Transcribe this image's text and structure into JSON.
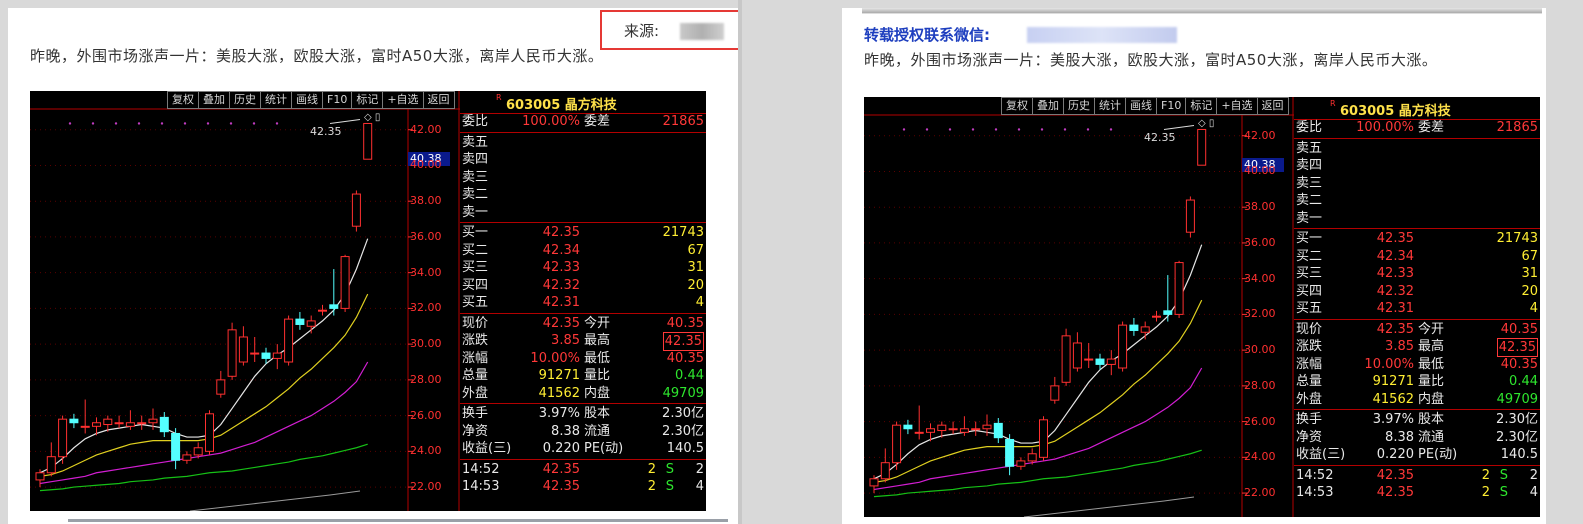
{
  "left": {
    "intro": "昨晚，外围市场涨声一片：美股大涨，欧股大涨，富时A50大涨，离岸人民币大涨。",
    "source_label": "来源:"
  },
  "right": {
    "reprint": "转载授权联系微信:",
    "intro": "昨晚，外围市场涨声一片：美股大涨，欧股大涨，富时A50大涨，离岸人民币大涨。"
  },
  "terminal": {
    "toolbar": [
      "复权",
      "叠加",
      "历史",
      "统计",
      "画线",
      "F10",
      "标记",
      "+自选",
      "返回"
    ],
    "axis_labels": [
      "42.00",
      "40.00",
      "38.00",
      "36.00",
      "34.00",
      "32.00",
      "30.00",
      "28.00",
      "26.00",
      "24.00",
      "22.00"
    ],
    "current_price": "40.38",
    "high_mark": "42.35",
    "stock_r": "R",
    "stock": "603005 晶方科技",
    "weibi": {
      "label": "委比",
      "value": "100.00%",
      "label2": "委差",
      "value2": "21865"
    },
    "asks": [
      "卖五",
      "卖四",
      "卖三",
      "卖二",
      "卖一"
    ],
    "bids": [
      {
        "label": "买一",
        "price": "42.35",
        "vol": "21743"
      },
      {
        "label": "买二",
        "price": "42.34",
        "vol": "67"
      },
      {
        "label": "买三",
        "price": "42.33",
        "vol": "31"
      },
      {
        "label": "买四",
        "price": "42.32",
        "vol": "20"
      },
      {
        "label": "买五",
        "price": "42.31",
        "vol": "4"
      }
    ],
    "stats": [
      {
        "l1": "现价",
        "v1": "42.35",
        "l2": "今开",
        "v2": "40.35"
      },
      {
        "l1": "涨跌",
        "v1": "3.85",
        "l2": "最高",
        "v2": "42.35"
      },
      {
        "l1": "涨幅",
        "v1": "10.00%",
        "l2": "最低",
        "v2": "40.35"
      },
      {
        "l1": "总量",
        "v1": "91271",
        "l2": "量比",
        "v2": "0.44"
      },
      {
        "l1": "外盘",
        "v1": "41562",
        "l2": "内盘",
        "v2": "49709"
      }
    ],
    "stats2": [
      {
        "l1": "换手",
        "v1": "3.97%",
        "l2": "股本",
        "v2": "2.30亿"
      },
      {
        "l1": "净资",
        "v1": "8.38",
        "l2": "流通",
        "v2": "2.30亿"
      },
      {
        "l1": "收益(三)",
        "v1": "0.220",
        "l2": "PE(动)",
        "v2": "140.5"
      }
    ],
    "ticks": [
      {
        "time": "14:52",
        "price": "42.35",
        "vol": "2",
        "dir": "S",
        "n": "2"
      },
      {
        "time": "14:53",
        "price": "42.35",
        "vol": "2",
        "dir": "S",
        "n": "4"
      }
    ]
  },
  "chart_data": {
    "type": "candlestick",
    "ylim": [
      21.5,
      42.6
    ],
    "candles": [
      {
        "o": 22.4,
        "h": 23.0,
        "l": 22.0,
        "c": 22.8
      },
      {
        "o": 22.8,
        "h": 24.5,
        "l": 22.6,
        "c": 23.7
      },
      {
        "o": 23.7,
        "h": 26.0,
        "l": 23.3,
        "c": 25.8
      },
      {
        "o": 25.8,
        "h": 26.1,
        "l": 25.3,
        "c": 25.6
      },
      {
        "o": 25.4,
        "h": 26.9,
        "l": 25.0,
        "c": 25.4
      },
      {
        "o": 25.4,
        "h": 25.9,
        "l": 24.9,
        "c": 25.6
      },
      {
        "o": 25.5,
        "h": 26.0,
        "l": 25.1,
        "c": 25.8
      },
      {
        "o": 25.6,
        "h": 26.0,
        "l": 25.3,
        "c": 25.6
      },
      {
        "o": 25.4,
        "h": 26.3,
        "l": 25.2,
        "c": 25.6
      },
      {
        "o": 25.6,
        "h": 26.0,
        "l": 25.2,
        "c": 25.6
      },
      {
        "o": 25.6,
        "h": 26.4,
        "l": 25.2,
        "c": 25.8
      },
      {
        "o": 25.9,
        "h": 26.2,
        "l": 24.8,
        "c": 25.1
      },
      {
        "o": 25.0,
        "h": 25.3,
        "l": 23.0,
        "c": 23.5
      },
      {
        "o": 23.5,
        "h": 24.0,
        "l": 23.3,
        "c": 23.8
      },
      {
        "o": 23.8,
        "h": 24.5,
        "l": 23.6,
        "c": 24.2
      },
      {
        "o": 24.0,
        "h": 26.3,
        "l": 23.8,
        "c": 26.1
      },
      {
        "o": 27.2,
        "h": 28.5,
        "l": 27.0,
        "c": 28.0
      },
      {
        "o": 28.2,
        "h": 31.2,
        "l": 28.0,
        "c": 30.8
      },
      {
        "o": 29.0,
        "h": 31.0,
        "l": 28.8,
        "c": 30.4
      },
      {
        "o": 29.5,
        "h": 30.4,
        "l": 29.0,
        "c": 29.5
      },
      {
        "o": 29.5,
        "h": 29.8,
        "l": 28.9,
        "c": 29.2
      },
      {
        "o": 29.2,
        "h": 30.0,
        "l": 28.6,
        "c": 29.5
      },
      {
        "o": 29.0,
        "h": 31.6,
        "l": 28.8,
        "c": 31.4
      },
      {
        "o": 31.4,
        "h": 31.8,
        "l": 30.8,
        "c": 31.1
      },
      {
        "o": 31.0,
        "h": 31.6,
        "l": 30.6,
        "c": 31.3
      },
      {
        "o": 31.9,
        "h": 32.2,
        "l": 31.6,
        "c": 31.9
      },
      {
        "o": 32.2,
        "h": 34.2,
        "l": 31.6,
        "c": 32.0
      },
      {
        "o": 32.0,
        "h": 35.0,
        "l": 31.8,
        "c": 34.9
      },
      {
        "o": 36.6,
        "h": 38.6,
        "l": 36.3,
        "c": 38.4
      },
      {
        "o": 40.35,
        "h": 42.35,
        "l": 40.35,
        "c": 42.35
      }
    ],
    "ma5": [
      22.8,
      23.1,
      23.6,
      24.2,
      24.7,
      25.0,
      25.2,
      25.3,
      25.4,
      25.5,
      25.4,
      25.3,
      25.0,
      24.8,
      24.8,
      24.9,
      25.5,
      26.4,
      27.3,
      28.2,
      28.9,
      29.4,
      29.8,
      30.3,
      30.8,
      31.3,
      31.9,
      32.8,
      34.2,
      35.9
    ],
    "ma10": [
      22.6,
      22.7,
      22.9,
      23.2,
      23.5,
      23.8,
      24.0,
      24.2,
      24.4,
      24.5,
      24.6,
      24.6,
      24.6,
      24.6,
      24.6,
      24.7,
      24.9,
      25.3,
      25.7,
      26.1,
      26.5,
      27.0,
      27.5,
      28.1,
      28.6,
      29.2,
      29.8,
      30.5,
      31.5,
      32.8
    ],
    "ma20": [
      22.2,
      22.3,
      22.4,
      22.5,
      22.6,
      22.8,
      22.9,
      23.0,
      23.1,
      23.2,
      23.3,
      23.4,
      23.5,
      23.6,
      23.7,
      23.8,
      23.9,
      24.1,
      24.3,
      24.5,
      24.8,
      25.1,
      25.4,
      25.7,
      26.0,
      26.4,
      26.8,
      27.3,
      27.9,
      29.0
    ],
    "ma60": [
      21.8,
      21.85,
      21.9,
      22.0,
      22.05,
      22.1,
      22.15,
      22.2,
      22.3,
      22.35,
      22.4,
      22.5,
      22.55,
      22.6,
      22.7,
      22.8,
      22.85,
      22.9,
      23.0,
      23.1,
      23.2,
      23.3,
      23.4,
      23.55,
      23.65,
      23.75,
      23.9,
      24.05,
      24.2,
      24.4
    ]
  }
}
